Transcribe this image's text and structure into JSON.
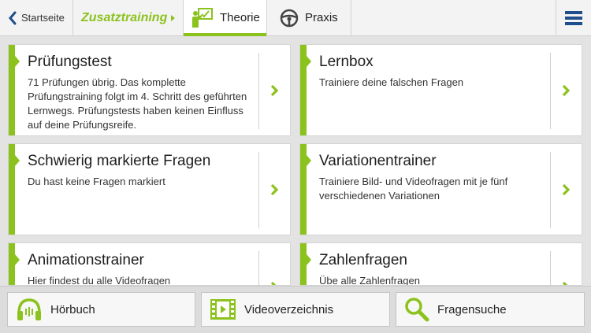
{
  "topbar": {
    "back_label": "Startseite",
    "breadcrumb": "Zusatztraining",
    "tabs": [
      {
        "label": "Theorie",
        "active": true
      },
      {
        "label": "Praxis",
        "active": false
      }
    ]
  },
  "cards": [
    {
      "title": "Prüfungstest",
      "description": "71 Prüfungen übrig. Das komplette Prüfungstraining folgt im 4. Schritt des geführten Lernwegs. Prüfungstests haben keinen Einfluss auf deine Prüfungsreife."
    },
    {
      "title": "Lernbox",
      "description": "Trainiere deine falschen Fragen"
    },
    {
      "title": "Schwierig markierte Fragen",
      "description": "Du hast keine Fragen markiert"
    },
    {
      "title": "Variationentrainer",
      "description": "Trainiere Bild- und Videofragen mit je fünf verschiedenen Variationen"
    },
    {
      "title": "Animationstrainer",
      "description": "Hier findest du alle Videofragen"
    },
    {
      "title": "Zahlenfragen",
      "description": "Übe alle Zahlenfragen"
    }
  ],
  "bottombar": {
    "audiobook_label": "Hörbuch",
    "videos_label": "Videoverzeichnis",
    "search_label": "Fragensuche"
  },
  "colors": {
    "accent": "#8cc21e",
    "menu_icon": "#1f4e8c",
    "back_chevron": "#1f4e8c"
  }
}
